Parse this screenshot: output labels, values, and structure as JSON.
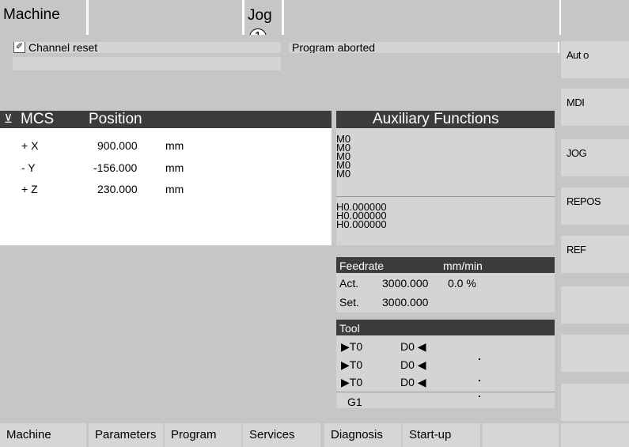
{
  "header": {
    "area": "Machine",
    "mode": "Jog",
    "marker": "1",
    "channel_status": "Channel reset",
    "program_status": "Program aborted"
  },
  "position": {
    "title_cs": "MCS",
    "title": "Position",
    "axes": [
      {
        "name": "+ X",
        "value": "900.000",
        "unit": "mm"
      },
      {
        "name": "- Y",
        "value": "-156.000",
        "unit": "mm"
      },
      {
        "name": "+ Z",
        "value": "230.000",
        "unit": "mm"
      }
    ]
  },
  "aux": {
    "title": "Auxiliary Functions",
    "m_functions": [
      "M0",
      "M0",
      "M0",
      "M0",
      "M0"
    ],
    "h_functions": [
      "H0.000000",
      "H0.000000",
      "H0.000000"
    ]
  },
  "feed": {
    "title": "Feedrate",
    "unit": "mm/min",
    "act_label": "Act.",
    "act_value": "3000.000",
    "act_pct": "0.0 %",
    "set_label": "Set.",
    "set_value": "3000.000"
  },
  "tool": {
    "title": "Tool",
    "rows": [
      {
        "t": "T0",
        "d": "D0"
      },
      {
        "t": "T0",
        "d": "D0"
      },
      {
        "t": "T0",
        "d": "D0"
      }
    ],
    "gcode": "G1"
  },
  "softkeys": [
    "Aut o",
    "MDI",
    "JOG",
    "REPOS",
    "REF",
    "",
    "",
    ""
  ],
  "hkeys": [
    "Machine",
    "Parameters",
    "Program",
    "Services",
    "Diagnosis",
    "Start-up",
    "",
    ""
  ]
}
